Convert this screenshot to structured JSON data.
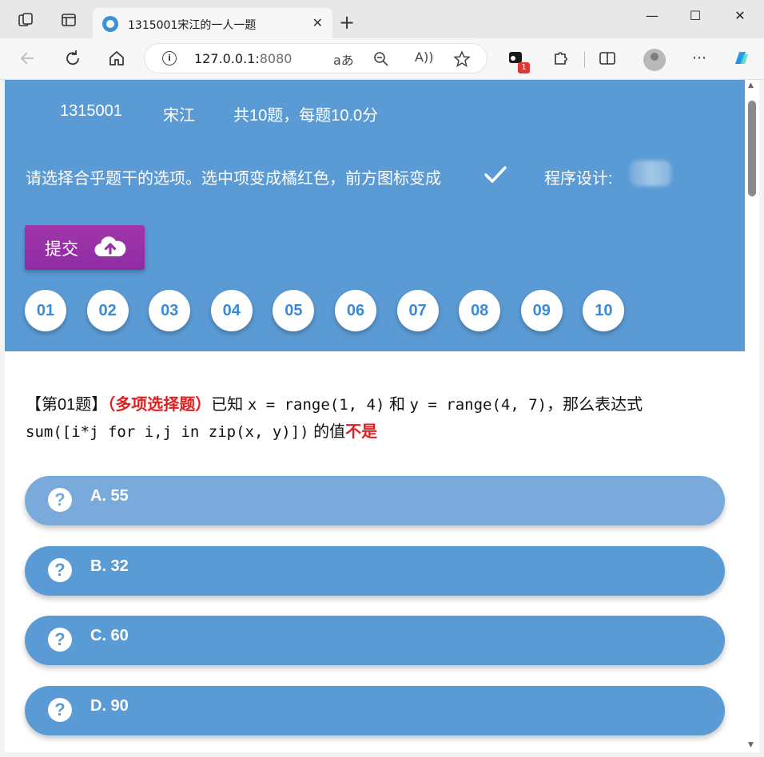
{
  "browser": {
    "tab_title": "1315001宋江的一人一题",
    "tab_close": "✕",
    "new_tab": "+",
    "url_host": "127.0.0.1:",
    "url_port": "8080",
    "ext_badge": "1",
    "controls": {
      "minimize": "—",
      "maximize": "☐",
      "close": "✕"
    }
  },
  "header": {
    "student_id": "1315001",
    "student_name": "宋江",
    "summary": "共10题，每题10.0分",
    "instruction": "请选择合乎题干的选项。选中项变成橘红色，前方图标变成",
    "program_label": "程序设计:",
    "submit_label": "提交"
  },
  "question_numbers": [
    "01",
    "02",
    "03",
    "04",
    "05",
    "06",
    "07",
    "08",
    "09",
    "10"
  ],
  "question": {
    "prefix": "【第01题】",
    "type": "（多项选择题）",
    "part1": "已知",
    "code1": "x = range(1, 4)",
    "part2": "和",
    "code2": "y = range(4, 7)",
    "part3": "，那么表达式",
    "code3": "sum([i*j for i,j in zip(x, y)])",
    "part4": "的值",
    "negation": "不是"
  },
  "options": [
    {
      "label": "A. 55",
      "state": "hover"
    },
    {
      "label": "B. 32",
      "state": "normal"
    },
    {
      "label": "C. 60",
      "state": "normal"
    },
    {
      "label": "D. 90",
      "state": "normal"
    }
  ],
  "colors": {
    "header_bg": "#5b9bd5",
    "submit_bg": "#9a30a8",
    "option_bg": "#5b9bd5",
    "option_hover_bg": "#7aaadb",
    "accent_red": "#e02020",
    "qnum_text": "#3a8ad9"
  },
  "icons": {
    "tab_actions": "tab-actions-icon",
    "sidebar": "sidebar-icon",
    "back": "back-arrow-icon",
    "refresh": "refresh-icon",
    "home": "home-icon",
    "info": "info-icon",
    "read_aloud": "read-aloud-icon",
    "zoom": "zoom-icon",
    "immersive": "immersive-reader-icon",
    "favorite": "star-icon",
    "extension": "puzzle-icon",
    "split": "split-screen-icon",
    "more": "more-icon",
    "copilot": "copilot-icon",
    "check": "checkmark-icon",
    "upload": "cloud-upload-icon",
    "question": "question-mark-icon"
  }
}
